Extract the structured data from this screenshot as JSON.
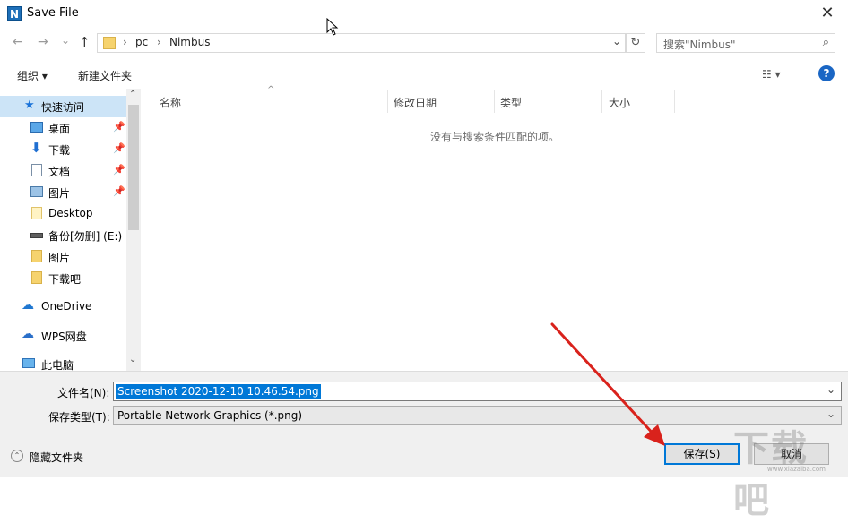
{
  "window": {
    "title": "Save File",
    "app_icon": "N",
    "close_glyph": "✕"
  },
  "nav": {
    "back_glyph": "←",
    "forward_glyph": "→",
    "recent_glyph": "⌄",
    "up_glyph": "↑",
    "breadcrumb": [
      "pc",
      "Nimbus"
    ],
    "breadcrumb_sep": "›",
    "address_dropdown_glyph": "⌄",
    "refresh_glyph": "↻",
    "search_placeholder": "搜索\"Nimbus\"",
    "search_glyph": "⌕"
  },
  "toolbar": {
    "organize": "组织 ▾",
    "new_folder": "新建文件夹",
    "view_glyph": "☷ ▾",
    "help": "?"
  },
  "sidebar": {
    "quick_access": "快速访问",
    "items": [
      {
        "label": "桌面",
        "icon": "desktop-icon",
        "pinned": true
      },
      {
        "label": "下载",
        "icon": "download-icon",
        "pinned": true
      },
      {
        "label": "文档",
        "icon": "document-icon",
        "pinned": true
      },
      {
        "label": "图片",
        "icon": "picture-icon",
        "pinned": true
      },
      {
        "label": "Desktop",
        "icon": "folder-icon",
        "pinned": false
      },
      {
        "label": "备份[勿删] (E:)",
        "icon": "drive-icon",
        "pinned": false
      },
      {
        "label": "图片",
        "icon": "folder-icon",
        "pinned": false
      },
      {
        "label": "下载吧",
        "icon": "folder-icon",
        "pinned": false
      }
    ],
    "onedrive": "OneDrive",
    "wps": "WPS网盘",
    "this_pc": "此电脑",
    "pin_glyph": "📌",
    "scroll_up": "⌃",
    "scroll_down": "⌄"
  },
  "columns": [
    "名称",
    "修改日期",
    "类型",
    "大小"
  ],
  "sort_glyph": "^",
  "empty_message": "没有与搜索条件匹配的项。",
  "form": {
    "filename_label": "文件名(N):",
    "filename_value": "Screenshot 2020-12-10 10.46.54.png",
    "filetype_label": "保存类型(T):",
    "filetype_value": "Portable Network Graphics (*.png)",
    "dropdown_glyph": "⌄"
  },
  "buttons": {
    "save": "保存(S)",
    "cancel": "取消",
    "hide_folders": "隐藏文件夹",
    "hide_glyph": "⌃"
  },
  "watermark": {
    "text": "下载吧",
    "sub": "www.xiazaiba.com"
  },
  "colors": {
    "accent": "#0078d7",
    "selection": "#cce4f7",
    "arrow": "#d9221c"
  }
}
